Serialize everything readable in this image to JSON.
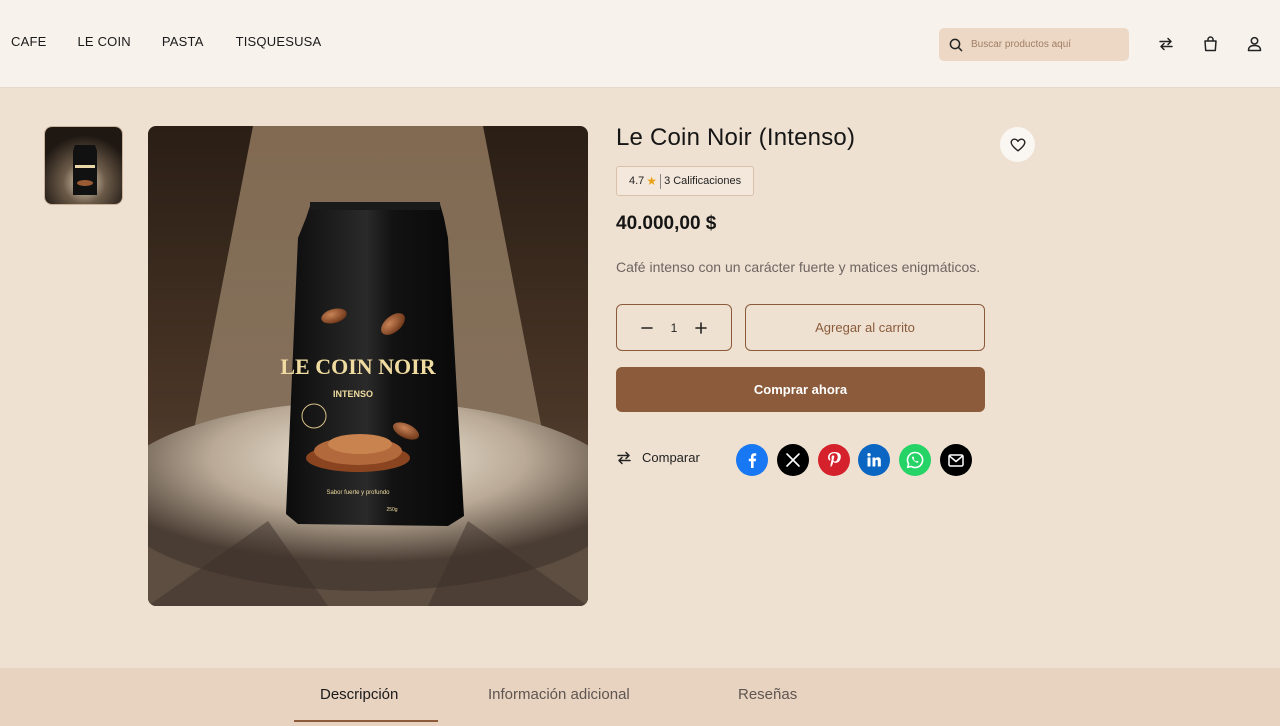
{
  "nav": {
    "items": [
      {
        "label": "CAFE"
      },
      {
        "label": "LE COIN"
      },
      {
        "label": "PASTA"
      },
      {
        "label": "TISQUESUSA"
      }
    ]
  },
  "search": {
    "placeholder": "Buscar productos aquí",
    "value": ""
  },
  "header_icons": [
    "compare-arrows-icon",
    "shopping-bag-icon",
    "user-icon"
  ],
  "product": {
    "title": "Le Coin Noir (Intenso)",
    "rating": "4.7",
    "ratings_count_label": "3 Calificaciones",
    "price": "40.000,00 $",
    "description": "Café intenso con un carácter fuerte y matices enigmáticos.",
    "quantity": "1",
    "add_to_cart_label": "Agregar al carrito",
    "buy_now_label": "Comprar ahora",
    "compare_label": "Comparar",
    "package": {
      "brand": "LE COIN NOIR",
      "variant": "INTENSO",
      "tagline": "Sabor fuerte y profundo",
      "weight": "250g"
    }
  },
  "share_icons": [
    "facebook-icon",
    "x-icon",
    "pinterest-icon",
    "linkedin-icon",
    "whatsapp-icon",
    "email-icon"
  ],
  "tabs": [
    {
      "label": "Descripción",
      "active": true
    },
    {
      "label": "Información adicional",
      "active": false
    },
    {
      "label": "Reseñas",
      "active": false
    }
  ],
  "colors": {
    "accent": "#8c5b3b",
    "page_bg": "#efe1d2",
    "header_bg": "#f8f2ec",
    "star": "#e8a31a"
  }
}
